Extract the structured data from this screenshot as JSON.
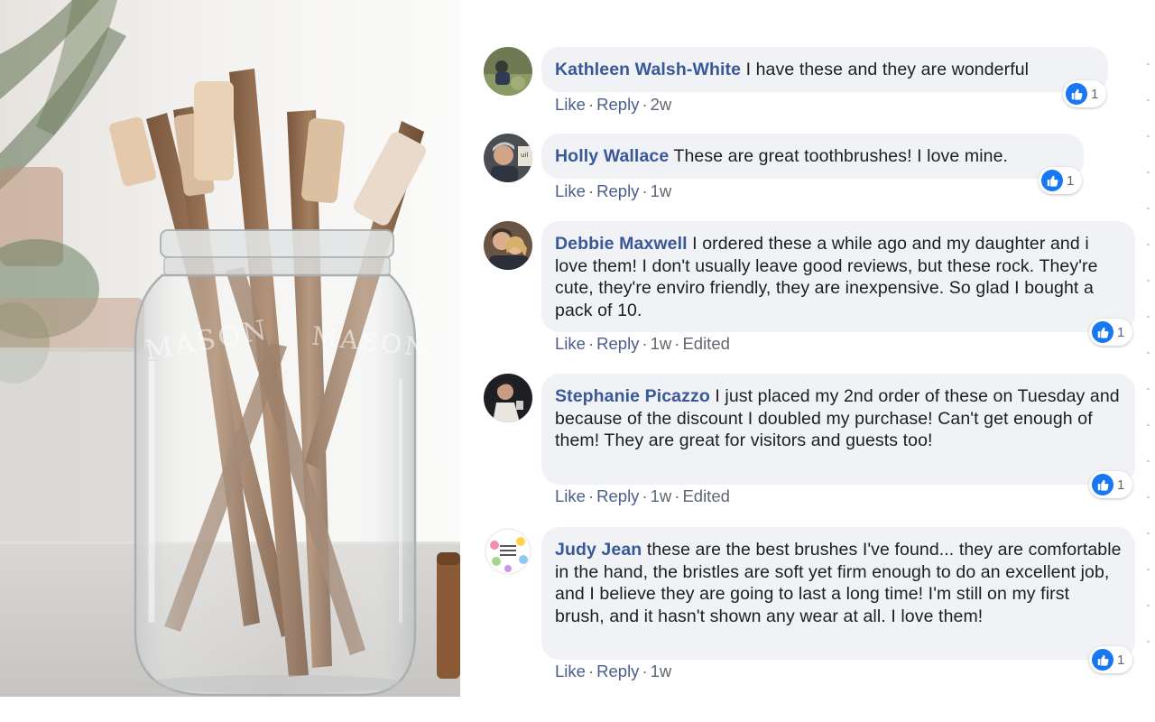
{
  "comments": [
    {
      "author": "Kathleen Walsh-White",
      "text": "I have these and they are wonderful",
      "like": "Like",
      "reply": "Reply",
      "time": "2w",
      "edited": "",
      "reactions": "1"
    },
    {
      "author": "Holly Wallace",
      "text": "These are great toothbrushes! I love mine.",
      "like": "Like",
      "reply": "Reply",
      "time": "1w",
      "edited": "",
      "reactions": "1"
    },
    {
      "author": "Debbie Maxwell",
      "text": "I ordered these a while ago and my daughter and i love them! I don't usually leave good reviews, but these rock. They're cute, they're enviro friendly, they are inexpensive. So glad I bought a pack of 10.",
      "like": "Like",
      "reply": "Reply",
      "time": "1w",
      "edited": "Edited",
      "reactions": "1"
    },
    {
      "author": "Stephanie Picazzo",
      "text": "I just placed my 2nd order of these on Tuesday and because of the discount I doubled my purchase! Can't get enough of them! They are great for visitors and guests too!",
      "like": "Like",
      "reply": "Reply",
      "time": "1w",
      "edited": "Edited",
      "reactions": "1"
    },
    {
      "author": "Judy Jean",
      "text": "these are the best brushes I've found... they are comfortable in the hand, the bristles are soft yet firm enough to do an excellent job, and I believe they are going to last a long time! I'm still on my first brush, and it hasn't shown any wear at all. I love them!",
      "like": "Like",
      "reply": "Reply",
      "time": "1w",
      "edited": "",
      "reactions": "1"
    }
  ],
  "photo": {
    "subject": "bamboo toothbrushes in glass jar",
    "jar_embossing": "MASON"
  },
  "colors": {
    "author_link": "#385898",
    "bubble_bg": "#f0f2f5",
    "like_blue": "#1877f2",
    "meta_text": "#606770"
  }
}
